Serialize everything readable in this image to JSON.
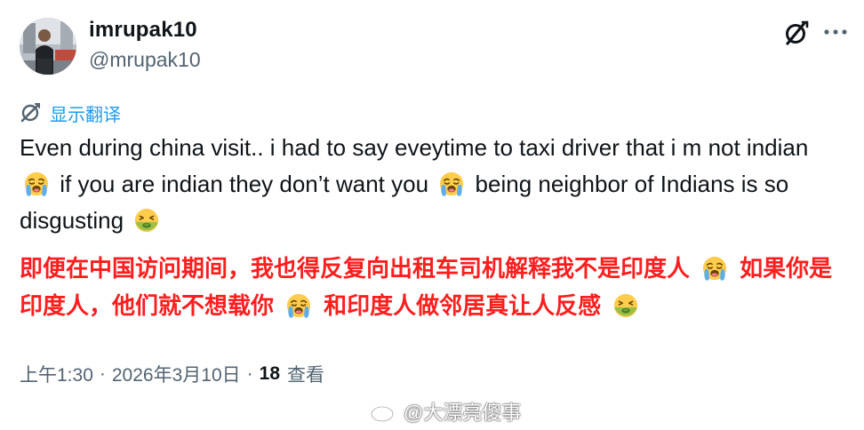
{
  "author": {
    "display_name": "imrupak10",
    "handle": "@mrupak10",
    "avatar_icon": "user-avatar-photo"
  },
  "actions": {
    "grok_icon": "grok-icon",
    "more_icon": "more-options-icon"
  },
  "translate": {
    "label": "显示翻译",
    "icon": "translate-icon",
    "color": "#1d9bf0"
  },
  "post": {
    "en_part1": "Even during china visit.. i had to say eveytime to taxi driver that i m not indian",
    "en_part2": "if you are indian they don’t want you",
    "en_part3": "being neighbor of Indians is so disgusting",
    "cn_part1": "即便在中国访问期间，我也得反复向出租车司机解释我不是印度人",
    "cn_part2": "如果你是印度人，他们就不想载你",
    "cn_part3": "和印度人做邻居真让人反感",
    "cn_color": "#ff1e1e",
    "emoji_1": "loudly-crying-face",
    "emoji_2": "loudly-crying-face",
    "emoji_3": "nauseated-face"
  },
  "meta": {
    "time": "上午1:30",
    "separator": "·",
    "date": "2026年3月10日",
    "views_count": "18",
    "views_label": "查看"
  },
  "watermark": {
    "text": "@大漂亮傻事",
    "icon": "weibo-logo"
  }
}
